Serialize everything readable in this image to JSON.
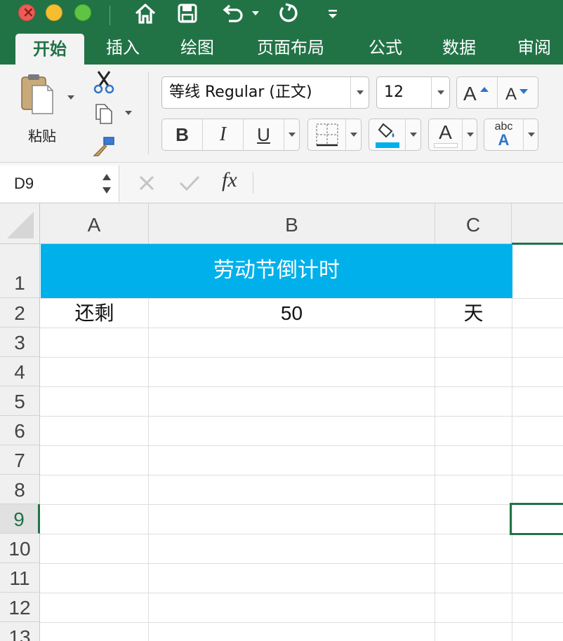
{
  "titlebar": {
    "window_controls": [
      "close",
      "minimize",
      "zoom"
    ],
    "quick_access_icons": [
      "home-icon",
      "save-icon",
      "undo-icon",
      "redo-icon",
      "customize-icon"
    ]
  },
  "tabs": [
    {
      "label": "开始",
      "active": true
    },
    {
      "label": "插入",
      "active": false
    },
    {
      "label": "绘图",
      "active": false
    },
    {
      "label": "页面布局",
      "active": false
    },
    {
      "label": "公式",
      "active": false
    },
    {
      "label": "数据",
      "active": false
    },
    {
      "label": "审阅",
      "active": false
    }
  ],
  "ribbon": {
    "paste_label": "粘贴",
    "font_name": "等线 Regular (正文)",
    "font_size": "12",
    "bold_label": "B",
    "italic_label": "I",
    "underline_label": "U",
    "font_color_label": "A",
    "phonetic_label": "abc",
    "phonetic_sub": "A",
    "fill_color": "#00b0eb",
    "font_color_swatch": "#ffffff"
  },
  "formula_bar": {
    "name_box": "D9",
    "fx_label": "fx",
    "formula": ""
  },
  "sheet": {
    "columns": [
      "A",
      "B",
      "C"
    ],
    "rows": [
      "1",
      "2",
      "3",
      "4",
      "5",
      "6",
      "7",
      "8",
      "9",
      "10",
      "11",
      "12",
      "13"
    ],
    "selected_row": "9",
    "title_cell": "劳动节倒计时",
    "title_fill": "#00b0eb",
    "row2": {
      "a": "还剩",
      "b": "50",
      "c": "天"
    },
    "selected_cell": "D9"
  }
}
